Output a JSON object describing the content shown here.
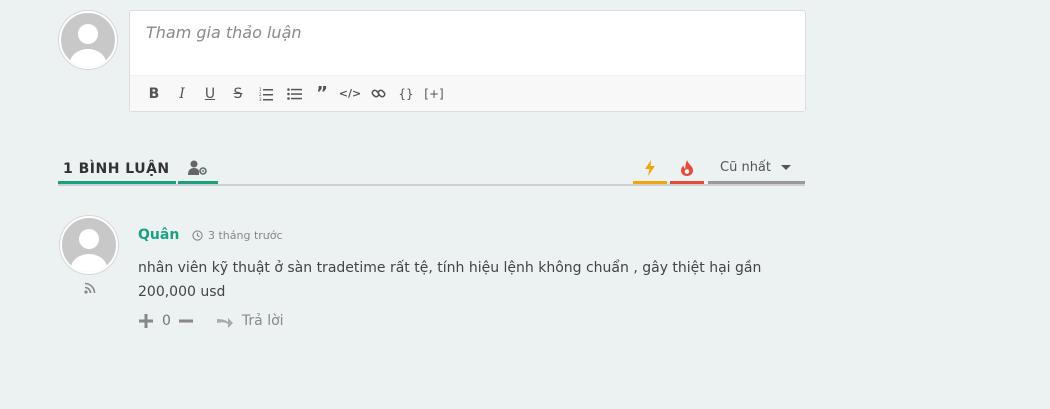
{
  "editor": {
    "placeholder": "Tham gia thảo luận",
    "toolbar": [
      "bold-icon",
      "italic-icon",
      "underline-icon",
      "strike-icon",
      "ordered-list-icon",
      "bullet-list-icon",
      "quote-icon",
      "code-icon",
      "link-icon",
      "code-block-icon",
      "spoiler-icon"
    ],
    "code_block_label": "{}",
    "spoiler_label": "[+]"
  },
  "tabs": {
    "count_label": "1 BÌNH LUẬN",
    "sort_label": "Cũ nhất"
  },
  "colors": {
    "accent": "#1ca082",
    "new": "#f0a50d",
    "hot": "#e64a3b"
  },
  "comment": {
    "author": "Quân",
    "time": "3 tháng trước",
    "text": "nhân viên kỹ thuật ở sàn tradetime rất tệ, tính hiệu lệnh không chuẩn , gây thiệt hại gần 200,000 usd",
    "votes": "0",
    "reply_label": "Trả lời"
  }
}
